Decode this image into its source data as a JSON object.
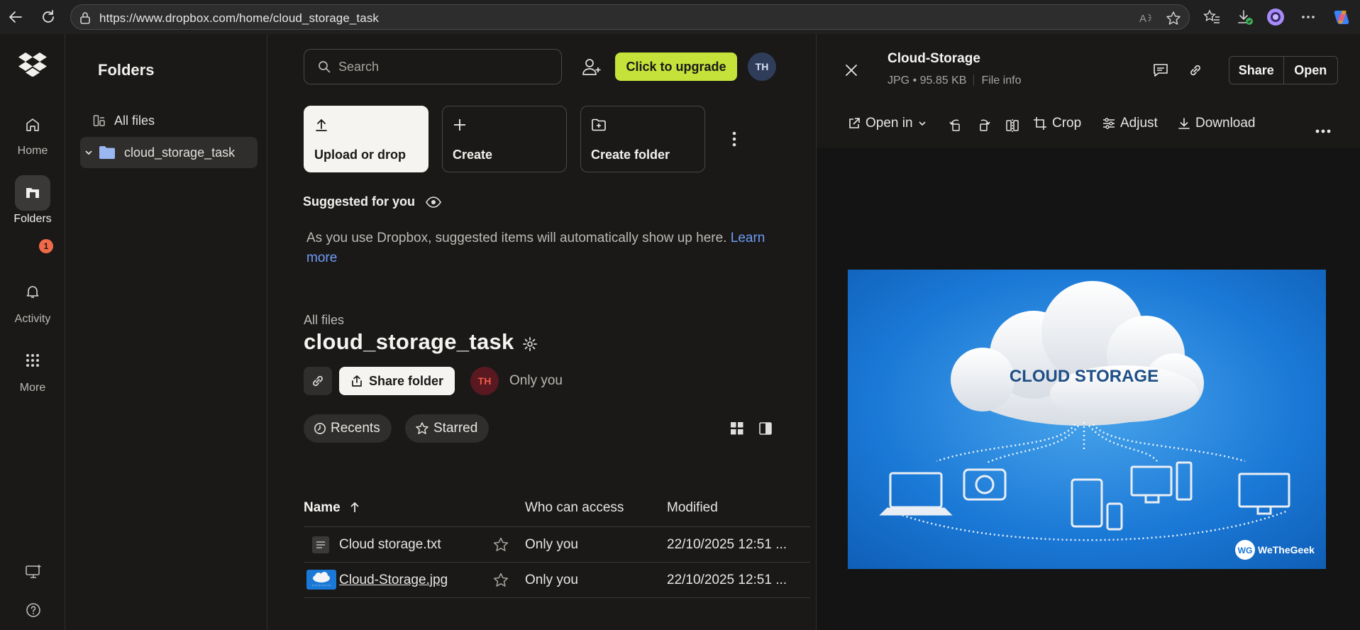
{
  "browser": {
    "url": "https://www.dropbox.com/home/cloud_storage_task"
  },
  "rail": {
    "items": [
      {
        "label": "Home",
        "icon": "home-icon"
      },
      {
        "label": "Folders",
        "icon": "folders-icon"
      },
      {
        "label": "Activity",
        "icon": "bell-icon"
      },
      {
        "label": "More",
        "icon": "grid-icon"
      }
    ],
    "activity_badge": "1"
  },
  "sidebar": {
    "title": "Folders",
    "all_files": "All files",
    "folder": "cloud_storage_task"
  },
  "header": {
    "search_placeholder": "Search",
    "upgrade_label": "Click to upgrade",
    "avatar_initials": "TH"
  },
  "actions": {
    "upload": "Upload or drop",
    "create": "Create",
    "create_folder": "Create folder"
  },
  "suggested": {
    "title": "Suggested for you",
    "text": "As you use Dropbox, suggested items will automatically show up here.",
    "link_1": "Learn",
    "link_2": "more"
  },
  "folder_view": {
    "breadcrumb": "All files",
    "title": "cloud_storage_task",
    "share_label": "Share folder",
    "member_initials": "TH",
    "access": "Only you",
    "filters": [
      "Recents",
      "Starred"
    ]
  },
  "table": {
    "columns": {
      "name": "Name",
      "access": "Who can access",
      "modified": "Modified"
    },
    "rows": [
      {
        "name": "Cloud storage.txt",
        "access": "Only you",
        "modified": "22/10/2025 12:51 ..."
      },
      {
        "name": "Cloud-Storage.jpg",
        "access": "Only you",
        "modified": "22/10/2025 12:51 ..."
      }
    ]
  },
  "preview": {
    "title": "Cloud-Storage",
    "meta": "JPG • 95.85 KB",
    "file_info": "File info",
    "share": "Share",
    "open": "Open",
    "toolbar": {
      "open_in": "Open in",
      "crop": "Crop",
      "adjust": "Adjust",
      "download": "Download"
    },
    "image": {
      "cloud_text": "CLOUD STORAGE",
      "watermark": "WeTheGeek",
      "watermark_mark": "WG"
    }
  },
  "colors": {
    "accent_upgrade": "#c4e23a",
    "link": "#6f9cf5",
    "badge": "#f06a48",
    "image_blue": "#1a78d6"
  }
}
